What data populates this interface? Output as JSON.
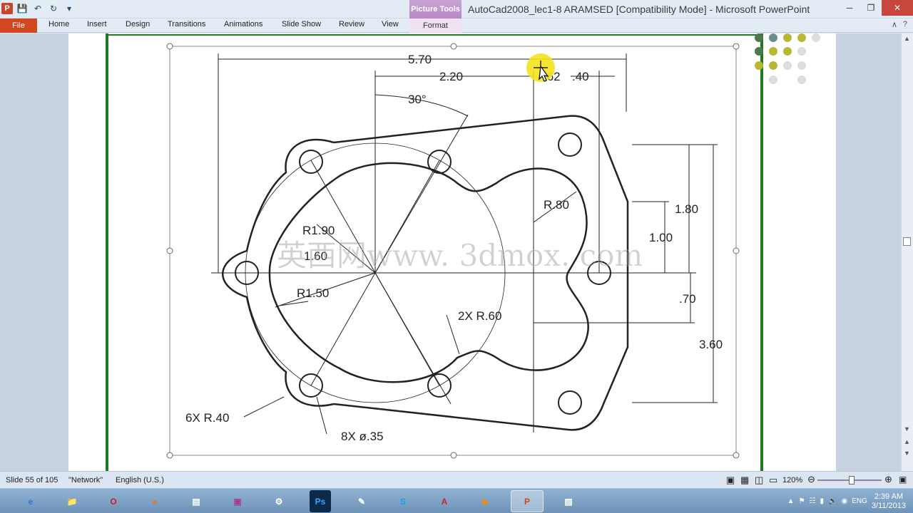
{
  "app": {
    "doc_title": "AutoCad2008_lec1-8 ARAMSED [Compatibility Mode]  -  Microsoft PowerPoint",
    "context_tab_title": "Picture Tools",
    "logo_letter": "P"
  },
  "ribbon": {
    "tabs": [
      "File",
      "Home",
      "Insert",
      "Design",
      "Transitions",
      "Animations",
      "Slide Show",
      "Review",
      "View",
      "Format"
    ]
  },
  "drawing": {
    "dims": {
      "total_width": "5.70",
      "offset": "2.20",
      "small_a": ".62",
      "small_b": ".40",
      "angle": "30°",
      "r_outer": "R1.90",
      "r_mid": "1.60",
      "r_inner": "R1.50",
      "r_lobe": "R.80",
      "lobe_count": "2X  R.60",
      "boss_r": "6X  R.40",
      "holes": "8X  ø.35",
      "v_180": "1.80",
      "v_100": "1.00",
      "v_070": ".70",
      "v_360": "3.60"
    },
    "watermark": "英西网www. 3dmox. com"
  },
  "statusbar": {
    "slide_info": "Slide 55 of 105",
    "theme": "\"Network\"",
    "language": "English (U.S.)",
    "zoom": "120%"
  },
  "taskbar": {
    "apps": [
      "IE",
      "Explorer",
      "Opera",
      "Firefox",
      "Library",
      "WinRAR",
      "Tools",
      "Ps",
      "Editor",
      "Skype",
      "AutoCAD",
      "Media",
      "PowerPoint",
      "Other"
    ],
    "tray_lang": "ENG",
    "time": "2:39 AM",
    "date": "3/11/2013"
  },
  "colors": {
    "accent_file": "#d2471f",
    "slide_border": "#1e7a1e",
    "context_tab": "#b68ac4",
    "dot_olive": "#b8b832",
    "dot_dark": "#4a7a4a"
  }
}
